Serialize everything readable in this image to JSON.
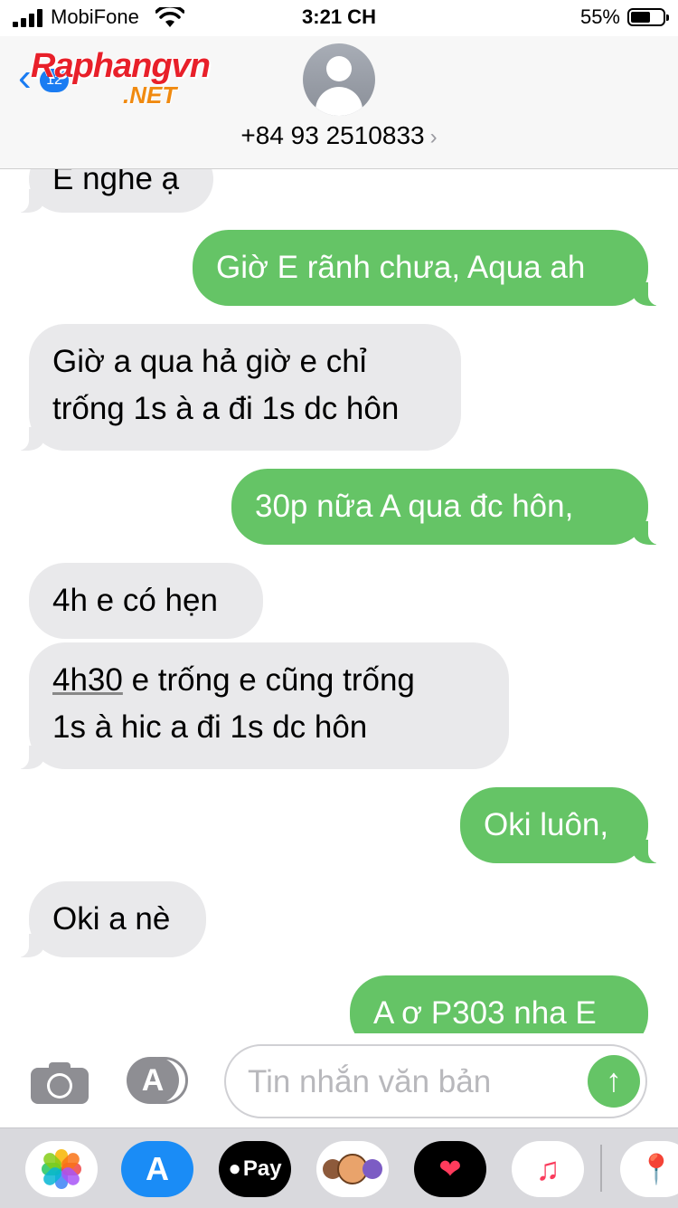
{
  "status_bar": {
    "carrier": "MobiFone",
    "time": "3:21 CH",
    "battery_percent": "55%",
    "battery_level": 0.55
  },
  "header": {
    "back_badge": "12",
    "contact_number": "+84 93 2510833",
    "watermark_top": "Raphangvn",
    "watermark_bottom": ".NET"
  },
  "messages": [
    {
      "direction": "incoming",
      "text": "E nghe ạ"
    },
    {
      "direction": "outgoing",
      "text": "Giờ E rãnh chưa, Aqua ah"
    },
    {
      "direction": "incoming",
      "lines": [
        "Giờ a qua hả giờ e chỉ",
        "trống 1s à a đi 1s dc hôn"
      ]
    },
    {
      "direction": "outgoing",
      "text": "30p nữa A qua đc hôn,"
    },
    {
      "direction": "incoming",
      "text": "4h e có hẹn"
    },
    {
      "direction": "incoming",
      "underlined": "4h30",
      "lines": [
        " e trống e cũng trống",
        "1s à hic a đi 1s dc hôn"
      ]
    },
    {
      "direction": "outgoing",
      "text": "Oki luôn,"
    },
    {
      "direction": "incoming",
      "text": "Oki a nè"
    },
    {
      "direction": "outgoing",
      "text": "A ơ P303 nha E"
    }
  ],
  "input_bar": {
    "placeholder": "Tin nhắn văn bản",
    "camera_icon": "camera-icon",
    "apps_icon": "app-store-icon",
    "send_icon": "send-arrow-icon"
  },
  "app_drawer": {
    "items": [
      "photos-icon",
      "app-store-icon",
      "apple-pay-icon",
      "memoji-icon",
      "digital-touch-icon",
      "music-icon",
      "maps-icon"
    ],
    "apple_pay_label": "Pay"
  },
  "colors": {
    "outgoing_bubble": "#65c466",
    "incoming_bubble": "#e9e9eb",
    "accent": "#1a7cf2",
    "watermark_red": "#e8202a",
    "watermark_orange": "#f08a10"
  }
}
